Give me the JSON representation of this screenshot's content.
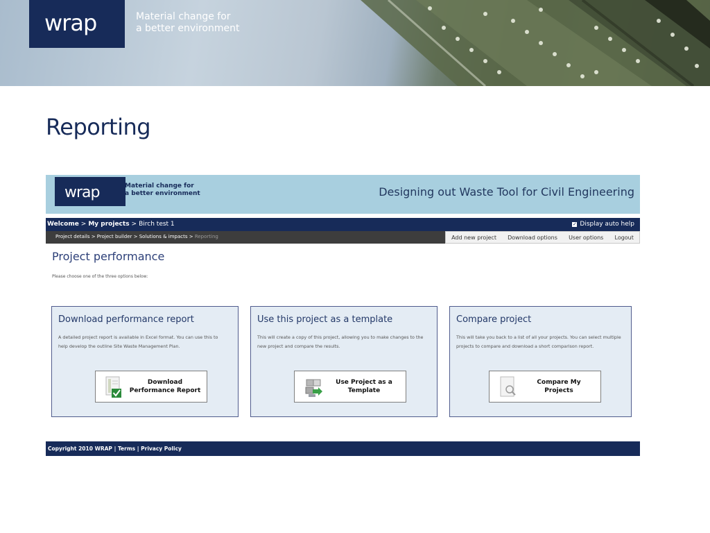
{
  "banner": {
    "logo": "wrap",
    "tagline_line1": "Material change for",
    "tagline_line2": "a better environment"
  },
  "slide": {
    "title": "Reporting"
  },
  "app": {
    "header": {
      "logo": "wrap",
      "tagline_line1": "Material change for",
      "tagline_line2": "a better environment",
      "title": "Designing out Waste Tool for Civil Engineering"
    },
    "nav1": {
      "welcome": "Welcome",
      "sep": ">",
      "my_projects": "My projects",
      "project": "Birch test 1",
      "display_auto_help": "Display auto help",
      "auto_help_checked": true
    },
    "nav2": {
      "crumbs": "Project details > Project builder > Solutions & impacts > ",
      "current": "Reporting",
      "menu": [
        "Add new project",
        "Download options",
        "User options",
        "Logout"
      ]
    },
    "main": {
      "title": "Project performance",
      "instruction": "Please choose one of the three options below:",
      "panels": [
        {
          "title": "Download performance report",
          "description": "A detailed project report is available in Excel format. You can use this to help develop the outline Site Waste Management Plan.",
          "button_line1": "Download",
          "button_line2": "Performance Report",
          "icon": "document-check-icon"
        },
        {
          "title": "Use this project as a template",
          "description": "This will create a copy of this project, allowing you to make changes to the new project and compare the results.",
          "button_line1": "Use Project as a",
          "button_line2": "Template",
          "icon": "copy-project-icon"
        },
        {
          "title": "Compare project",
          "description": "This will take you back to a list of all your projects. You can select multiple projects to compare and download a short comparison report.",
          "button_line1": "Compare My",
          "button_line2": "Projects",
          "icon": "document-search-icon"
        }
      ]
    },
    "footer": {
      "copyright": "Copyright 2010 WRAP",
      "sep": "|",
      "terms": "Terms",
      "privacy": "Privacy Policy"
    }
  },
  "colors": {
    "brand_navy": "#172b59",
    "header_blue": "#a8cfdf",
    "panel_bg": "#e4ecf4",
    "panel_border": "#4f5b8c",
    "nav_grey": "#3d3d3d"
  }
}
